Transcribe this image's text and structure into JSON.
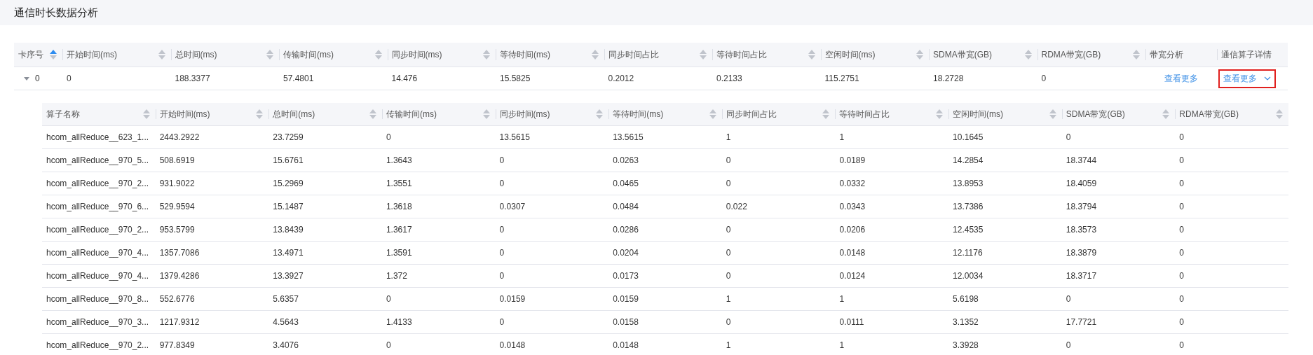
{
  "page": {
    "title": "通信时长数据分析"
  },
  "table": {
    "columns": [
      {
        "label": "卡序号",
        "sortable": true,
        "sorted": true
      },
      {
        "label": "开始时间(ms)",
        "sortable": true,
        "sorted": false
      },
      {
        "label": "总时间(ms)",
        "sortable": true,
        "sorted": false
      },
      {
        "label": "传输时间(ms)",
        "sortable": true,
        "sorted": false
      },
      {
        "label": "同步时间(ms)",
        "sortable": true,
        "sorted": false
      },
      {
        "label": "等待时间(ms)",
        "sortable": true,
        "sorted": false
      },
      {
        "label": "同步时间占比",
        "sortable": true,
        "sorted": false
      },
      {
        "label": "等待时间占比",
        "sortable": true,
        "sorted": false
      },
      {
        "label": "空闲时间(ms)",
        "sortable": true,
        "sorted": false
      },
      {
        "label": "SDMA带宽(GB)",
        "sortable": true,
        "sorted": false
      },
      {
        "label": "RDMA带宽(GB)",
        "sortable": true,
        "sorted": false
      },
      {
        "label": "带宽分析",
        "sortable": false
      },
      {
        "label": "通信算子详情",
        "sortable": false
      }
    ],
    "rows": [
      {
        "expanded": true,
        "cells": [
          "0",
          "0",
          "188.3377",
          "57.4801",
          "14.476",
          "15.5825",
          "0.2012",
          "0.2133",
          "115.2751",
          "18.2728",
          "0"
        ],
        "links": [
          {
            "label": "查看更多",
            "dropdown": false,
            "highlighted": false
          },
          {
            "label": "查看更多",
            "dropdown": true,
            "highlighted": true
          }
        ],
        "detail": {
          "columns": [
            {
              "label": "算子名称",
              "sortable": true,
              "sorted": false
            },
            {
              "label": "开始时间(ms)",
              "sortable": true,
              "sorted": false
            },
            {
              "label": "总时间(ms)",
              "sortable": true,
              "sorted": false
            },
            {
              "label": "传输时间(ms)",
              "sortable": true,
              "sorted": false
            },
            {
              "label": "同步时间(ms)",
              "sortable": true,
              "sorted": false
            },
            {
              "label": "等待时间(ms)",
              "sortable": true,
              "sorted": false
            },
            {
              "label": "同步时间占比",
              "sortable": true,
              "sorted": false
            },
            {
              "label": "等待时间占比",
              "sortable": true,
              "sorted": false
            },
            {
              "label": "空闲时间(ms)",
              "sortable": true,
              "sorted": false
            },
            {
              "label": "SDMA带宽(GB)",
              "sortable": true,
              "sorted": false
            },
            {
              "label": "RDMA带宽(GB)",
              "sortable": true,
              "sorted": false
            }
          ],
          "rows": [
            [
              "hcom_allReduce__623_1...",
              "2443.2922",
              "23.7259",
              "0",
              "13.5615",
              "13.5615",
              "1",
              "1",
              "10.1645",
              "0",
              "0"
            ],
            [
              "hcom_allReduce__970_5...",
              "508.6919",
              "15.6761",
              "1.3643",
              "0",
              "0.0263",
              "0",
              "0.0189",
              "14.2854",
              "18.3744",
              "0"
            ],
            [
              "hcom_allReduce__970_2...",
              "931.9022",
              "15.2969",
              "1.3551",
              "0",
              "0.0465",
              "0",
              "0.0332",
              "13.8953",
              "18.4059",
              "0"
            ],
            [
              "hcom_allReduce__970_6...",
              "529.9594",
              "15.1487",
              "1.3618",
              "0.0307",
              "0.0484",
              "0.022",
              "0.0343",
              "13.7386",
              "18.3794",
              "0"
            ],
            [
              "hcom_allReduce__970_2...",
              "953.5799",
              "13.8439",
              "1.3617",
              "0",
              "0.0286",
              "0",
              "0.0206",
              "12.4535",
              "18.3573",
              "0"
            ],
            [
              "hcom_allReduce__970_4...",
              "1357.7086",
              "13.4971",
              "1.3591",
              "0",
              "0.0204",
              "0",
              "0.0148",
              "12.1176",
              "18.3879",
              "0"
            ],
            [
              "hcom_allReduce__970_4...",
              "1379.4286",
              "13.3927",
              "1.372",
              "0",
              "0.0173",
              "0",
              "0.0124",
              "12.0034",
              "18.3717",
              "0"
            ],
            [
              "hcom_allReduce__970_8...",
              "552.6776",
              "5.6357",
              "0",
              "0.0159",
              "0.0159",
              "1",
              "1",
              "5.6198",
              "0",
              "0"
            ],
            [
              "hcom_allReduce__970_3...",
              "1217.9312",
              "4.5643",
              "1.4133",
              "0",
              "0.0158",
              "0",
              "0.0111",
              "3.1352",
              "17.7721",
              "0"
            ],
            [
              "hcom_allReduce__970_2...",
              "977.8349",
              "3.4076",
              "0",
              "0.0148",
              "0.0148",
              "1",
              "1",
              "3.3928",
              "0",
              "0"
            ]
          ]
        }
      }
    ]
  }
}
